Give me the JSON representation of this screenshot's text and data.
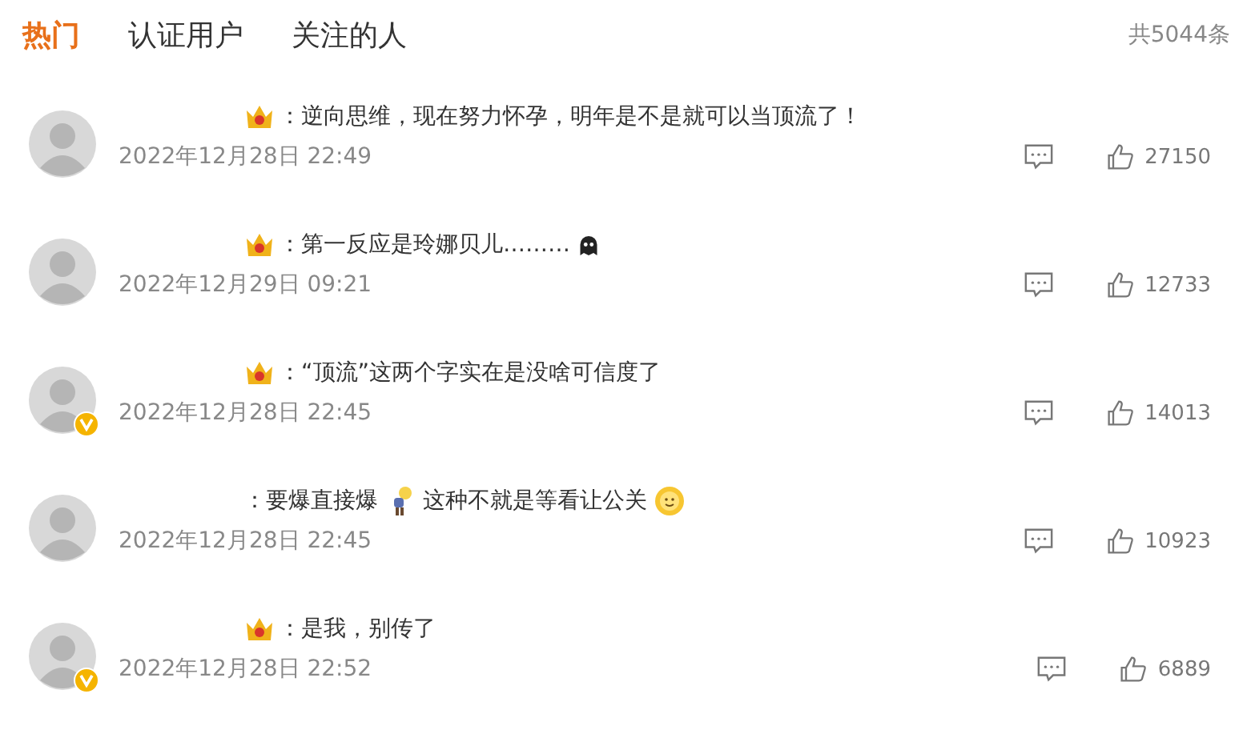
{
  "tabs": [
    {
      "label": "热门",
      "selected": true
    },
    {
      "label": "认证用户",
      "selected": false
    },
    {
      "label": "关注的人",
      "selected": false
    }
  ],
  "total": "共5044条",
  "comments": [
    {
      "crown": true,
      "verified": false,
      "parts": [
        {
          "kind": "text",
          "text": "：逆向思维，现在努力怀孕，明年是不是就可以当顶流了！"
        }
      ],
      "date": "2022年12月28日 22:49",
      "likes": "27150"
    },
    {
      "crown": true,
      "verified": false,
      "parts": [
        {
          "kind": "text",
          "text": "：第一反应是玲娜贝儿………"
        },
        {
          "kind": "ghost"
        }
      ],
      "date": "2022年12月29日 09:21",
      "likes": "12733"
    },
    {
      "crown": true,
      "verified": true,
      "parts": [
        {
          "kind": "text",
          "text": "：“顶流”这两个字实在是没啥可信度了"
        }
      ],
      "date": "2022年12月28日 22:45",
      "likes": "14013"
    },
    {
      "crown": false,
      "verified": false,
      "parts": [
        {
          "kind": "text",
          "text": "：要爆直接爆"
        },
        {
          "kind": "figure"
        },
        {
          "kind": "text",
          "text": "这种不就是等看让公关"
        },
        {
          "kind": "sun"
        }
      ],
      "date": "2022年12月28日 22:45",
      "likes": "10923"
    },
    {
      "crown": true,
      "verified": true,
      "parts": [
        {
          "kind": "text",
          "text": "：是我，别传了"
        }
      ],
      "date": "2022年12月28日 22:52",
      "likes": "6889"
    }
  ]
}
